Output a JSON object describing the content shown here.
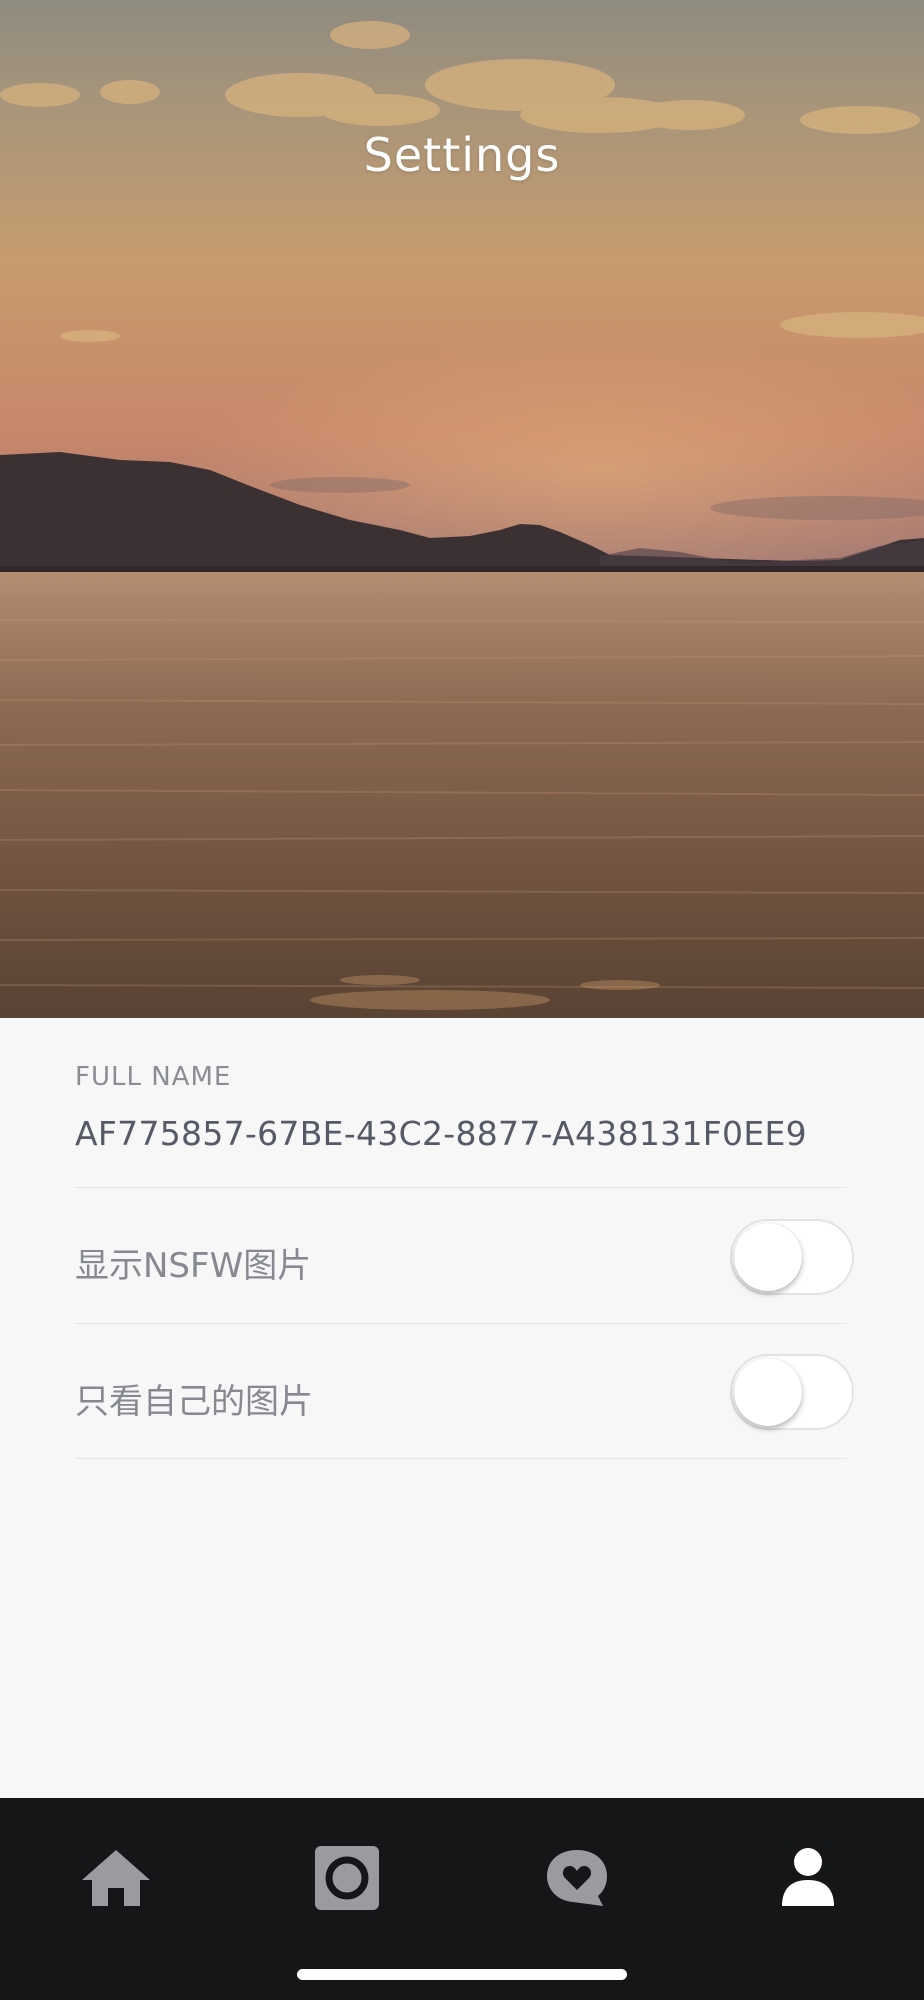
{
  "header": {
    "title": "Settings"
  },
  "profile": {
    "full_name_label": "FULL NAME",
    "full_name_value": "AF775857-67BE-43C2-8877-A438131F0EE9"
  },
  "settings": [
    {
      "label": "显示NSFW图片",
      "enabled": false
    },
    {
      "label": "只看自己的图片",
      "enabled": false
    }
  ],
  "tabbar": {
    "tabs": [
      {
        "icon": "home-icon",
        "active": false
      },
      {
        "icon": "camera-icon",
        "active": false
      },
      {
        "icon": "heart-chat-icon",
        "active": false
      },
      {
        "icon": "profile-icon",
        "active": true
      }
    ],
    "colors": {
      "inactive": "#9a9ba0",
      "active": "#ffffff",
      "background": "#151617"
    }
  }
}
